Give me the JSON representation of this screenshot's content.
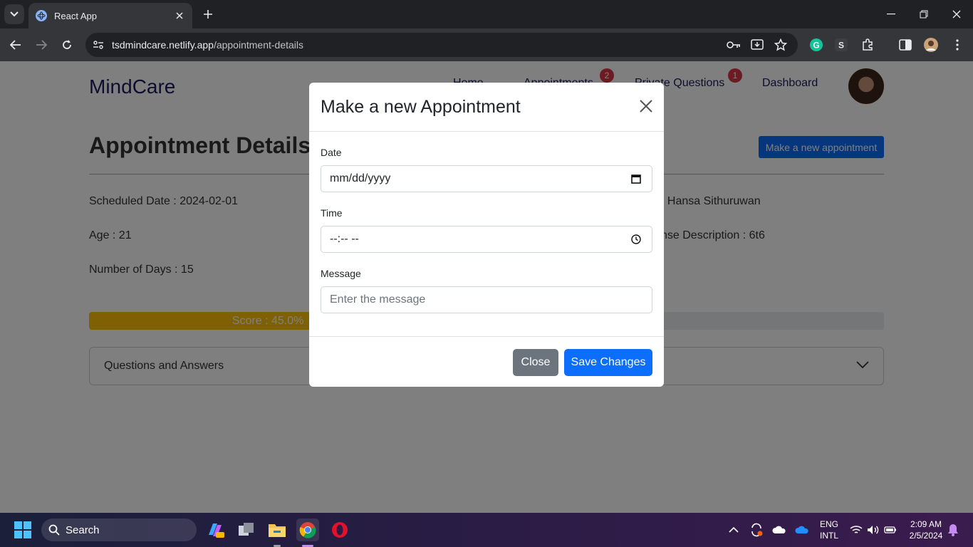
{
  "browser": {
    "tab_title": "React App",
    "url_domain": "tsdmindcare.netlify.app",
    "url_path": "/appointment-details"
  },
  "page": {
    "brand": "MindCare",
    "nav": {
      "home": "Home",
      "appointments": "Appointments",
      "appointments_badge": "2",
      "private_questions": "Private Questions",
      "private_questions_badge": "1",
      "dashboard": "Dashboard"
    },
    "title": "Appointment Details",
    "new_appointment_button": "Make a new appointment",
    "details": {
      "scheduled_date": "Scheduled Date : 2024-02-01",
      "age": "Age : 21",
      "number_of_days": "Number of Days : 15",
      "name_partial": ": Hansa Sithuruwan",
      "description_partial": "nse Description : 6t6"
    },
    "score": {
      "label": "Score : 45.0%",
      "percent": 45.0
    },
    "accordion_label": "Questions and Answers"
  },
  "modal": {
    "title": "Make a new Appointment",
    "date_label": "Date",
    "date_placeholder": "mm/dd/yyyy",
    "time_label": "Time",
    "time_placeholder": "--:-- --",
    "message_label": "Message",
    "message_placeholder": "Enter the message",
    "close_button": "Close",
    "save_button": "Save Changes"
  },
  "taskbar": {
    "search_label": "Search",
    "lang_line1": "ENG",
    "lang_line2": "INTL",
    "time": "2:09 AM",
    "date": "2/5/2024"
  },
  "colors": {
    "primary": "#0d6efd",
    "secondary": "#6c757d",
    "warning": "#ffc107",
    "danger": "#dc3545"
  }
}
